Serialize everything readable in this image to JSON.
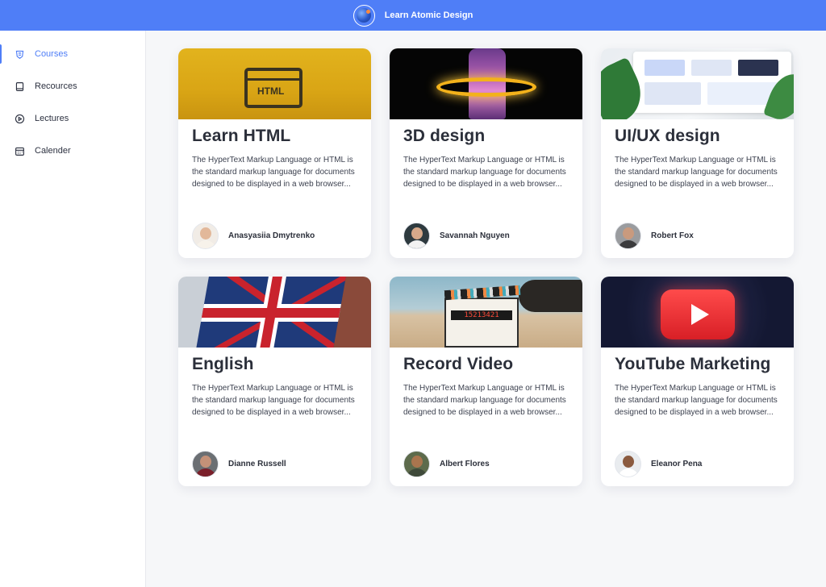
{
  "header": {
    "title": "Learn Atomic Design",
    "logo_icon": "globe-logo-icon"
  },
  "sidebar": {
    "active_color": "#4f7ef7",
    "items": [
      {
        "label": "Courses",
        "icon": "courses-icon",
        "active": true
      },
      {
        "label": "Recources",
        "icon": "book-icon",
        "active": false
      },
      {
        "label": "Lectures",
        "icon": "play-circle-icon",
        "active": false
      },
      {
        "label": "Calender",
        "icon": "calendar-icon",
        "active": false
      }
    ]
  },
  "courses": [
    {
      "title": "Learn HTML",
      "description": "The HyperText Markup Language or HTML is the standard markup language for documents designed to be displayed in a web browser...",
      "author": "Anasyasiia Dmytrenko",
      "thumbnail": "html-window-image"
    },
    {
      "title": "3D design",
      "description": "The HyperText Markup Language or HTML is the standard markup language for documents designed to be displayed in a web browser...",
      "author": "Savannah Nguyen",
      "thumbnail": "3d-hand-ring-image"
    },
    {
      "title": "UI/UX design",
      "description": "The HyperText Markup Language or HTML is the standard markup language for documents designed to be displayed in a web browser...",
      "author": "Robert Fox",
      "thumbnail": "ui-dashboard-image"
    },
    {
      "title": "English",
      "description": "The HyperText Markup Language or HTML is the standard markup language for documents designed to be displayed in a web browser...",
      "author": "Dianne Russell",
      "thumbnail": "uk-flag-image"
    },
    {
      "title": "Record Video",
      "description": "The HyperText Markup Language or HTML is the standard markup language for documents designed to be displayed in a web browser...",
      "author": "Albert Flores",
      "thumbnail": "clapperboard-image"
    },
    {
      "title": "YouTube Marketing",
      "description": "The HyperText Markup Language or HTML is the standard markup language for documents designed to be displayed in a web browser...",
      "author": "Eleanor Pena",
      "thumbnail": "youtube-button-image"
    }
  ],
  "thumbnail_text": {
    "html_label": "HTML",
    "clapper_digits": "15213421"
  }
}
